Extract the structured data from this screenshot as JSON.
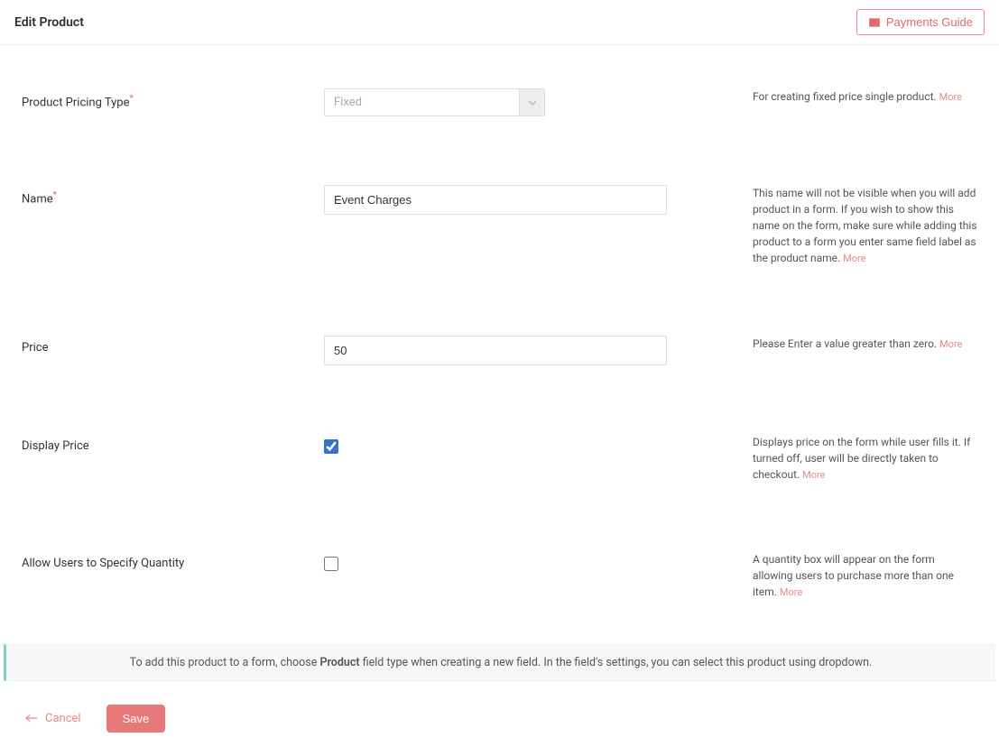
{
  "header": {
    "title": "Edit Product",
    "guide_button": "Payments Guide"
  },
  "fields": {
    "pricing_type": {
      "label": "Product Pricing Type",
      "required": true,
      "value": "Fixed",
      "help": "For creating fixed price single product.",
      "more": "More"
    },
    "name": {
      "label": "Name",
      "required": true,
      "value": "Event Charges",
      "help": "This name will not be visible when you will add product in a form. If you wish to show this name on the form, make sure while adding this product to a form you enter same field label as the product name.",
      "more": "More"
    },
    "price": {
      "label": "Price",
      "required": false,
      "value": "50",
      "help": "Please Enter a value greater than zero.",
      "more": "More"
    },
    "display_price": {
      "label": "Display Price",
      "checked": true,
      "help": "Displays price on the form while user fills it. If turned off, user will be directly taken to checkout.",
      "more": "More"
    },
    "allow_qty": {
      "label": "Allow Users to Specify Quantity",
      "checked": false,
      "help": "A quantity box will appear on the form allowing users to purchase more than one item.",
      "more": "More"
    }
  },
  "info_bar": {
    "prefix": "To add this product to a form, choose ",
    "bold": "Product",
    "suffix": " field type when creating a new field. In the field's settings, you can select this product using dropdown."
  },
  "footer": {
    "cancel": "Cancel",
    "save": "Save"
  }
}
